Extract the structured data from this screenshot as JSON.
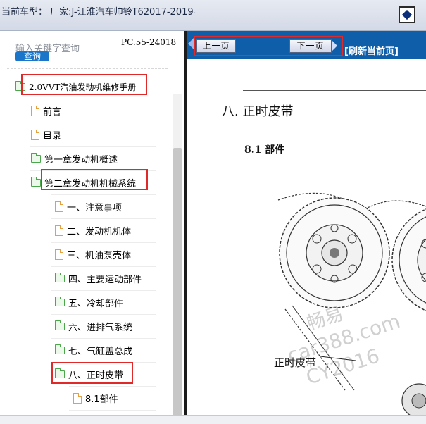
{
  "header": {
    "title": "当前车型： 厂家:J-江淮汽车帅铃T62017-2019",
    "dot": "."
  },
  "search": {
    "placeholder": "输入关键字查询",
    "button_label": "查询",
    "doc_code": "PC.55-24018"
  },
  "tree": {
    "items": [
      {
        "label": "2.0VVT汽油发动机维修手册",
        "icon": "folder-open-icon"
      },
      {
        "label": "前言",
        "icon": "document-icon"
      },
      {
        "label": "目录",
        "icon": "document-icon"
      },
      {
        "label": "第一章发动机概述",
        "icon": "folder-icon"
      },
      {
        "label": "第二章发动机机械系统",
        "icon": "folder-open-icon"
      },
      {
        "label": "一、注意事项",
        "icon": "document-icon"
      },
      {
        "label": "二、发动机机体",
        "icon": "document-icon"
      },
      {
        "label": "三、机油泵壳体",
        "icon": "document-icon"
      },
      {
        "label": "四、主要运动部件",
        "icon": "folder-icon"
      },
      {
        "label": "五、冷却部件",
        "icon": "folder-icon"
      },
      {
        "label": "六、进排气系统",
        "icon": "folder-icon"
      },
      {
        "label": "七、气缸盖总成",
        "icon": "folder-icon"
      },
      {
        "label": "八、正时皮带",
        "icon": "folder-open-icon"
      },
      {
        "label": "8.1部件",
        "icon": "document-icon"
      }
    ]
  },
  "viewer": {
    "prev_label": "上一页",
    "next_label": "下一页",
    "refresh_label": "[刷新当前页]",
    "section_heading": "八. 正时皮带",
    "sub_heading": "8.1 部件",
    "callout_label": "正时皮带",
    "watermark_lines": [
      "畅易",
      "car388.com",
      "CY2016"
    ]
  },
  "colors": {
    "toolbar_blue": "#0f5ea9",
    "search_button": "#1b76c9",
    "highlight_red": "#e02a2a",
    "folder_green": "#4aa84a",
    "doc_orange": "#e5a040"
  }
}
